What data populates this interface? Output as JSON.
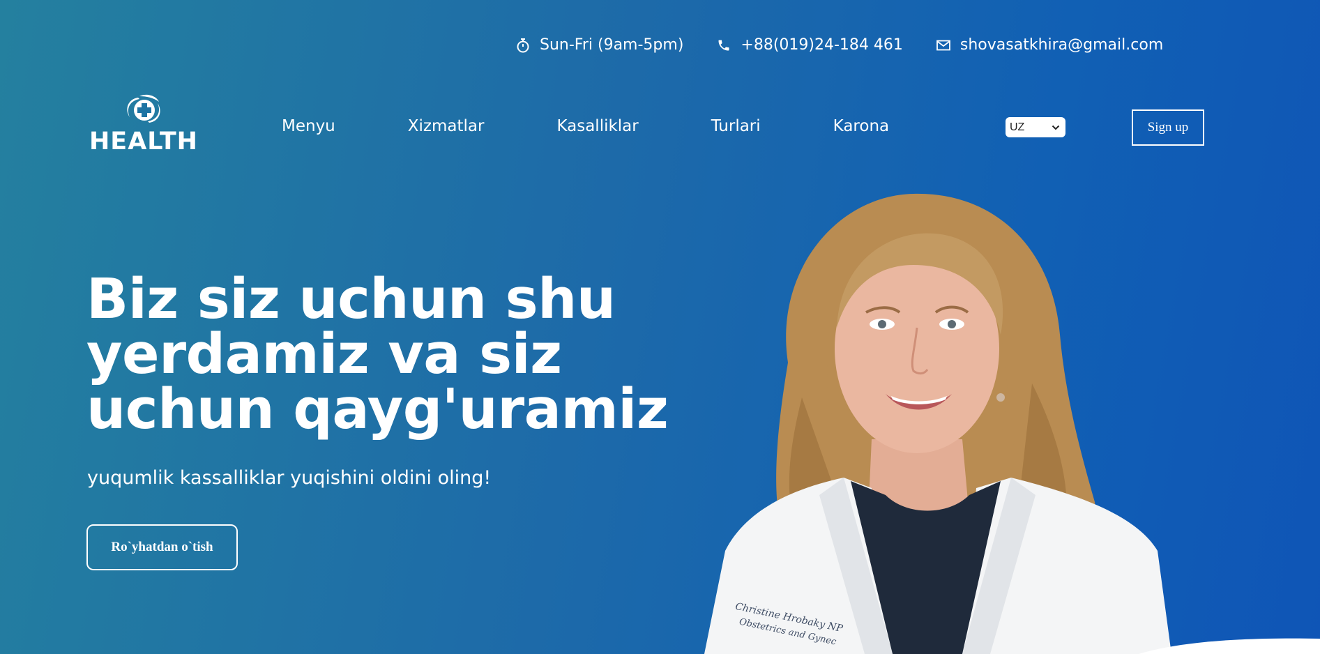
{
  "topbar": {
    "hours": "Sun-Fri (9am-5pm)",
    "phone": "+88(019)24-184 461",
    "email": "shovasatkhira@gmail.com",
    "icons": [
      "stopwatch-icon",
      "phone-icon",
      "mail-icon"
    ]
  },
  "logo": {
    "text": "HEALTH"
  },
  "nav": {
    "items": [
      {
        "label": "Menyu"
      },
      {
        "label": "Xizmatlar"
      },
      {
        "label": "Kasalliklar"
      },
      {
        "label": "Turlari"
      },
      {
        "label": "Karona"
      }
    ]
  },
  "language": {
    "selected": "UZ"
  },
  "signup": {
    "label": "Sign up"
  },
  "hero": {
    "title_line1": "Biz siz uchun shu",
    "title_line2": "yerdamiz va siz",
    "title_line3": "uchun qayg'uramiz",
    "subtitle": "yuqumlik kassalliklar yuqishini oldini oling!",
    "button_label": "Ro`yhatdan o`tish",
    "embroidery_line1": "Christine Hrobaky NP",
    "embroidery_line2": "Obstetrics and Gynec"
  },
  "colors": {
    "bg_start": "#24809f",
    "bg_end": "#0f55b6",
    "text": "#ffffff",
    "hair": "#b98c52",
    "coat": "#f4f5f6"
  }
}
